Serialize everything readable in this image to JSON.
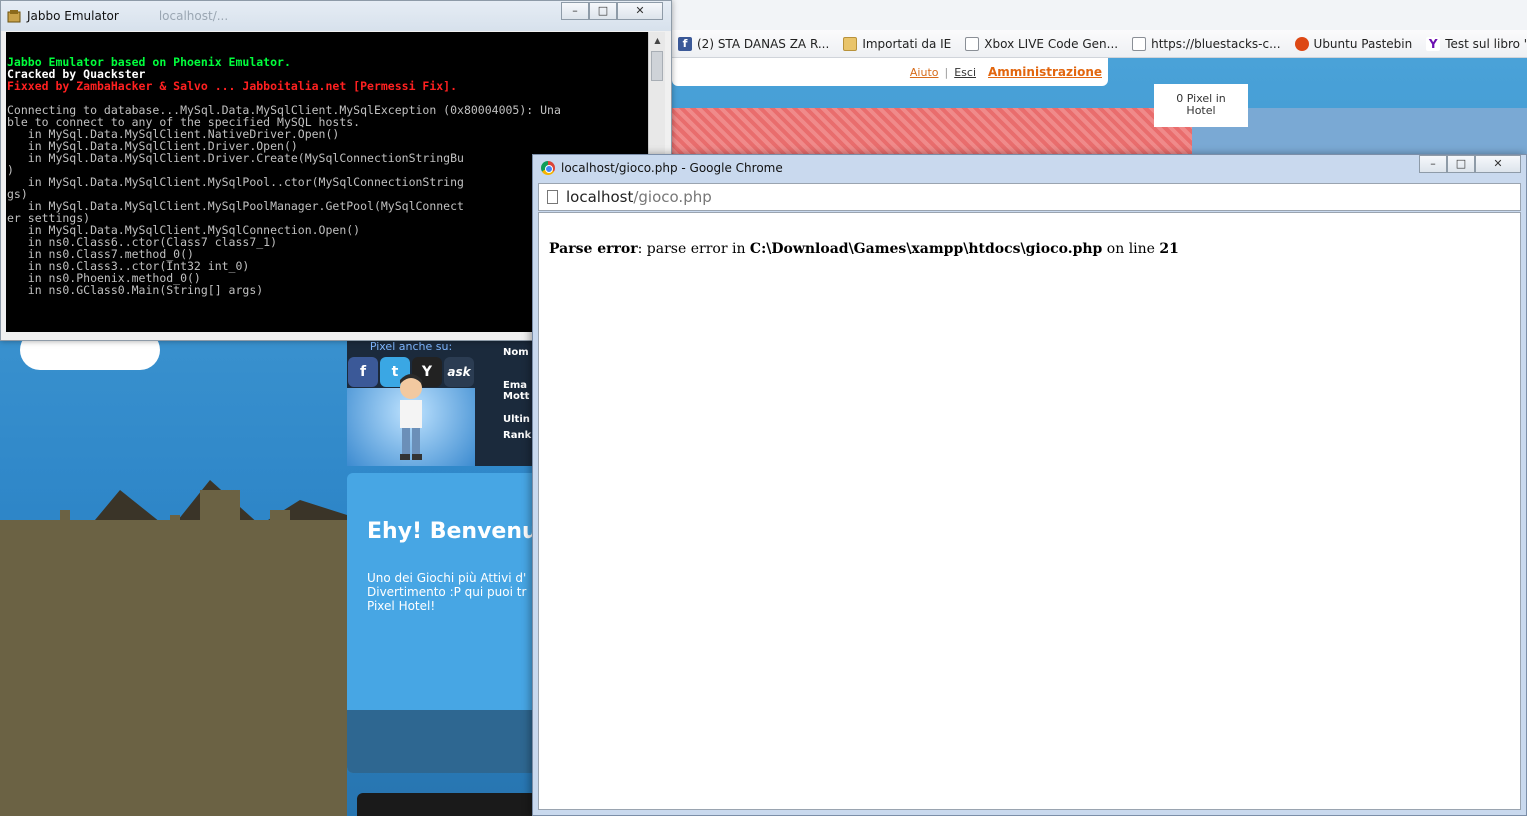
{
  "background_browser": {
    "bookmarks": [
      {
        "icon": "facebook-icon",
        "label": "(2) STA DANAS ZA R..."
      },
      {
        "icon": "folder-icon",
        "label": "Importati da IE"
      },
      {
        "icon": "page-icon",
        "label": "Xbox LIVE Code Gen..."
      },
      {
        "icon": "page-icon",
        "label": "https://bluestacks-c..."
      },
      {
        "icon": "ubuntu-icon",
        "label": "Ubuntu Pastebin"
      },
      {
        "icon": "yahoo-icon",
        "label": "Test sul libro \"Harry ..."
      }
    ],
    "hotel_menu": {
      "help": "Aiuto",
      "separator": "|",
      "logout": "Esci",
      "admin": "Amministrazione"
    },
    "pixel_count": "0 Pixel in",
    "pixel_location": "Hotel",
    "social_header": "Pixel anche su:",
    "social_buttons": [
      "f",
      "t",
      "Y",
      "ask"
    ],
    "profile_labels": [
      "Nom",
      "Ema",
      "Mott",
      "Ultin",
      "Rank"
    ],
    "welcome_title": "Ehy! Benvenu",
    "welcome_text_lines": [
      "Uno dei Giochi più Attivi d'",
      "Divertimento :P qui puoi tr",
      "Pixel Hotel!"
    ]
  },
  "console_window": {
    "title": "Jabbo Emulator",
    "faded_tab": "localhost/...",
    "buttons": {
      "minimize": "–",
      "maximize": "□",
      "close": "✕"
    },
    "lines": [
      {
        "style": "green",
        "text": "Jabbo Emulator based on Phoenix Emulator."
      },
      {
        "style": "white",
        "text": "Cracked by Quackster"
      },
      {
        "style": "red",
        "text": "Fixxed by ZambaHacker & Salvo ... Jabboitalia.net [Permessi Fix]."
      },
      {
        "style": "plain",
        "text": ""
      },
      {
        "style": "plain",
        "text": "Connecting to database...MySql.Data.MySqlClient.MySqlException (0x80004005): Una"
      },
      {
        "style": "plain",
        "text": "ble to connect to any of the specified MySQL hosts."
      },
      {
        "style": "plain",
        "text": "   in MySql.Data.MySqlClient.NativeDriver.Open()"
      },
      {
        "style": "plain",
        "text": "   in MySql.Data.MySqlClient.Driver.Open()"
      },
      {
        "style": "plain",
        "text": "   in MySql.Data.MySqlClient.Driver.Create(MySqlConnectionStringBu"
      },
      {
        "style": "plain",
        "text": ")"
      },
      {
        "style": "plain",
        "text": "   in MySql.Data.MySqlClient.MySqlPool..ctor(MySqlConnectionString"
      },
      {
        "style": "plain",
        "text": "gs)"
      },
      {
        "style": "plain",
        "text": "   in MySql.Data.MySqlClient.MySqlPoolManager.GetPool(MySqlConnect"
      },
      {
        "style": "plain",
        "text": "er settings)"
      },
      {
        "style": "plain",
        "text": "   in MySql.Data.MySqlClient.MySqlConnection.Open()"
      },
      {
        "style": "plain",
        "text": "   in ns0.Class6..ctor(Class7 class7_1)"
      },
      {
        "style": "plain",
        "text": "   in ns0.Class7.method_0()"
      },
      {
        "style": "plain",
        "text": "   in ns0.Class3..ctor(Int32 int_0)"
      },
      {
        "style": "plain",
        "text": "   in ns0.Phoenix.method_0()"
      },
      {
        "style": "plain",
        "text": "   in ns0.GClass0.Main(String[] args)"
      }
    ]
  },
  "chrome_window": {
    "title": "localhost/gioco.php - Google Chrome",
    "buttons": {
      "minimize": "–",
      "maximize": "□",
      "close": "✕"
    },
    "address_host": "localhost",
    "address_path": "/gioco.php",
    "error": {
      "label": "Parse error",
      "message": ": parse error in ",
      "file": "C:\\Download\\Games\\xampp\\htdocs\\gioco.php",
      "on_line_text": " on line ",
      "line": "21"
    }
  },
  "colors": {
    "console_green": "#00ff3c",
    "console_red": "#ff2020",
    "admin_link": "#e2660e",
    "welcome_panel": "#47a6e4"
  }
}
